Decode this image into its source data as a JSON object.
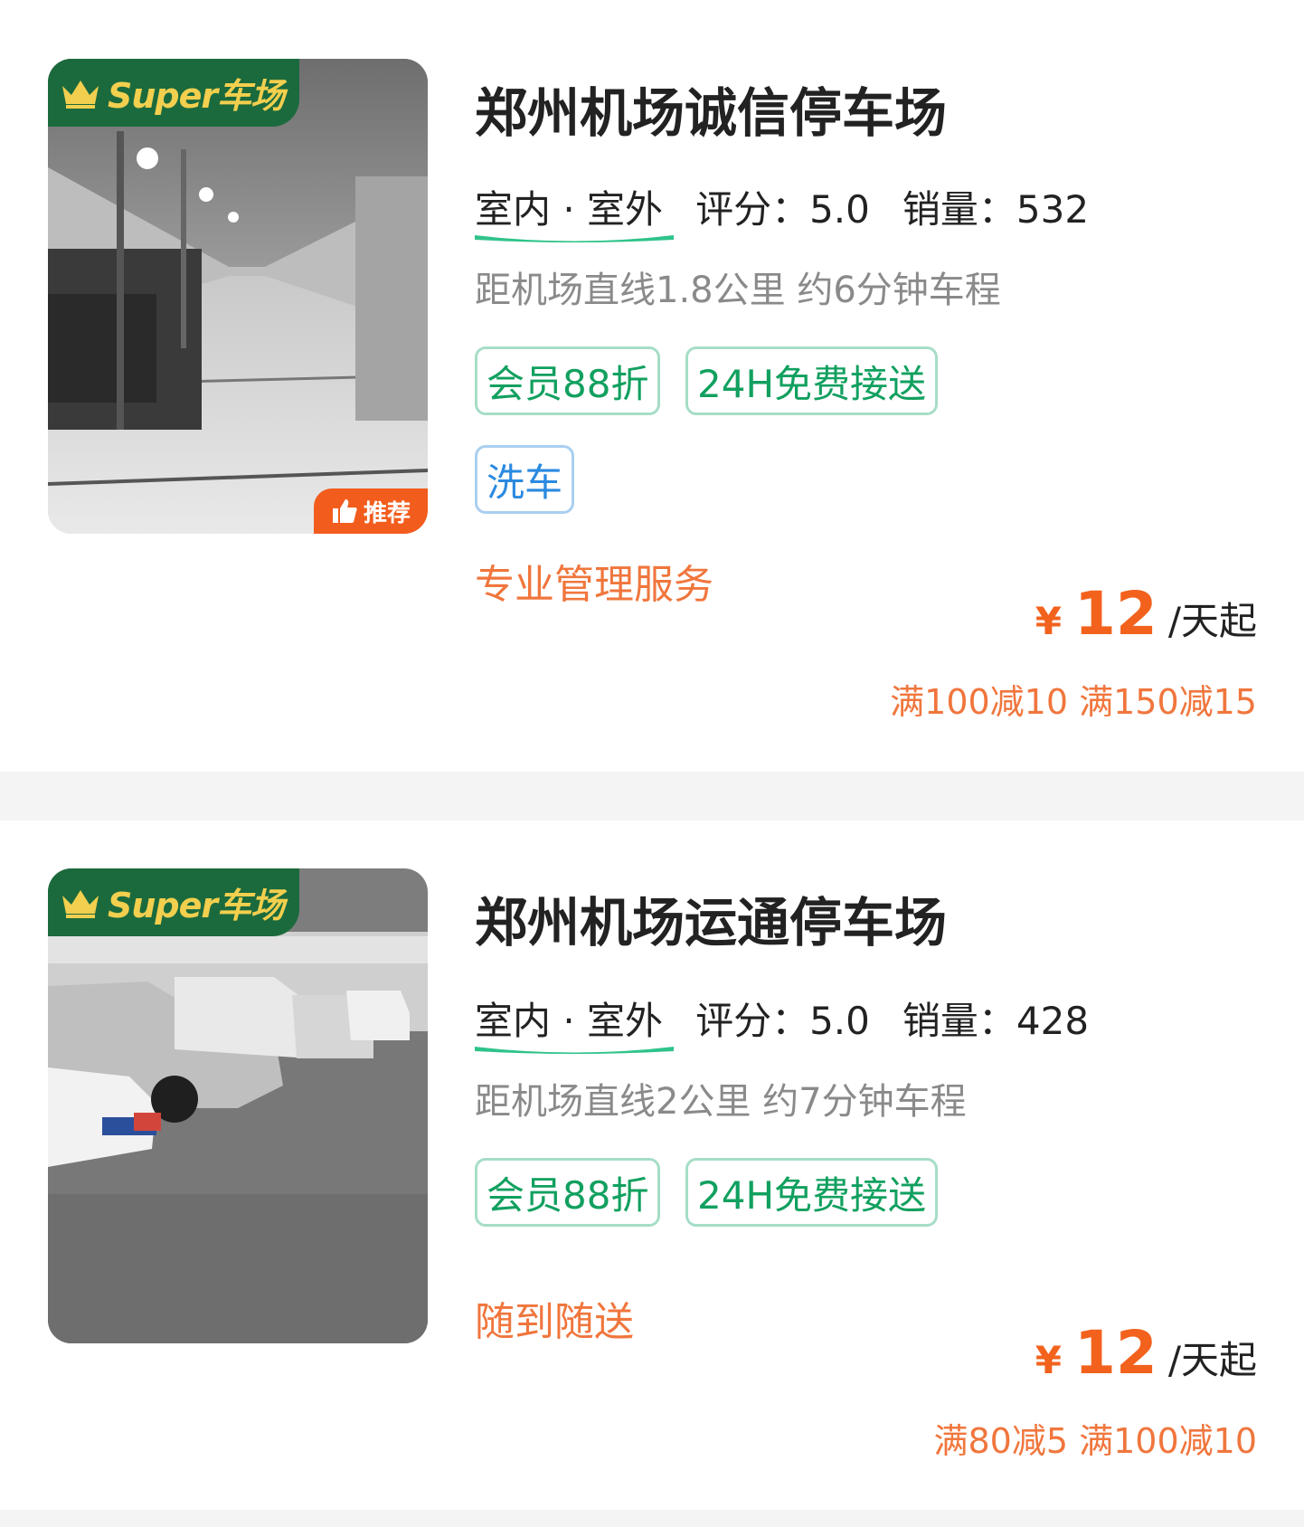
{
  "listings": [
    {
      "badge": "Super车场",
      "recommend": "推荐",
      "name": "郑州机场诚信停车场",
      "environment": "室内 · 室外",
      "rating_label": "评分：",
      "rating": "5.0",
      "sales_label": "销量：",
      "sales": "532",
      "distance": "距机场直线1.8公里 约6分钟车程",
      "tags": [
        "会员88折",
        "24H免费接送",
        "洗车"
      ],
      "feature": "专业管理服务",
      "price_currency": "¥",
      "price": "12",
      "price_unit": "/天起",
      "discounts": "满100减10 满150减15"
    },
    {
      "badge": "Super车场",
      "name": "郑州机场运通停车场",
      "environment": "室内 · 室外",
      "rating_label": "评分：",
      "rating": "5.0",
      "sales_label": "销量：",
      "sales": "428",
      "distance": "距机场直线2公里 约7分钟车程",
      "tags": [
        "会员88折",
        "24H免费接送"
      ],
      "feature": "随到随送",
      "price_currency": "¥",
      "price": "12",
      "price_unit": "/天起",
      "discounts": "满80减5 满100减10"
    }
  ],
  "colors": {
    "badge_green": "#1b6a3d",
    "badge_gold": "#f2cf4e",
    "price_orange": "#f2621d",
    "tag_green": "#11a05f",
    "tag_blue": "#2a8ae0"
  },
  "icons": [
    "crown-icon",
    "thumbs-up-icon",
    "underline-swoosh"
  ]
}
